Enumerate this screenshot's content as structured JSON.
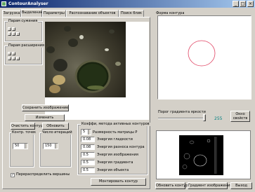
{
  "window": {
    "title": "ContourAnalyser",
    "btn_min": "_",
    "btn_max": "□",
    "btn_close": "×"
  },
  "tabs": [
    {
      "label": "Загрузка"
    },
    {
      "label": "Выделение"
    },
    {
      "label": "Параметры"
    },
    {
      "label": "Распознавание объектов"
    },
    {
      "label": "Поиск блик"
    }
  ],
  "left": {
    "blur_group": "Парам сужения",
    "expand_group": "Парам расширения",
    "save_image": "Сохранить изображение",
    "change": "Изменить",
    "clear_contour": "Очистить контур",
    "refresh": "Обновить",
    "points_label": "Контр. точек",
    "iterations_label": "Число итераций",
    "points_value": "50",
    "iterations_value": "150",
    "redistribute": "Перераспределить вершины",
    "redistribute_checked": true
  },
  "coeffs": {
    "group": "Коэффи, метода активных контуров",
    "matrix_value": "5",
    "matrix_label": "Размерность матрицы Р",
    "rows": [
      {
        "value": "0.08",
        "label": "Энергия гладкости"
      },
      {
        "value": "0.08",
        "label": "Энергия разноса контура"
      },
      {
        "value": "0.5",
        "label": "Энергия изображения"
      },
      {
        "value": "0.5",
        "label": "Энергия градиента"
      },
      {
        "value": "0.5",
        "label": "Энергия объекта"
      }
    ],
    "fit_contour": "Монтировать контур"
  },
  "right": {
    "contour_form": "Форма контура",
    "threshold_label": "Порог градиента яркости",
    "threshold_value": "255",
    "window_props": "Окно свойств",
    "update_contour": "Обновить контур",
    "gradient_image": "Градиент изображения",
    "exit": "Выход"
  },
  "colors": {
    "contour": "#e04060",
    "threshold_text": "#008080",
    "titlebar": "#0a246a"
  }
}
